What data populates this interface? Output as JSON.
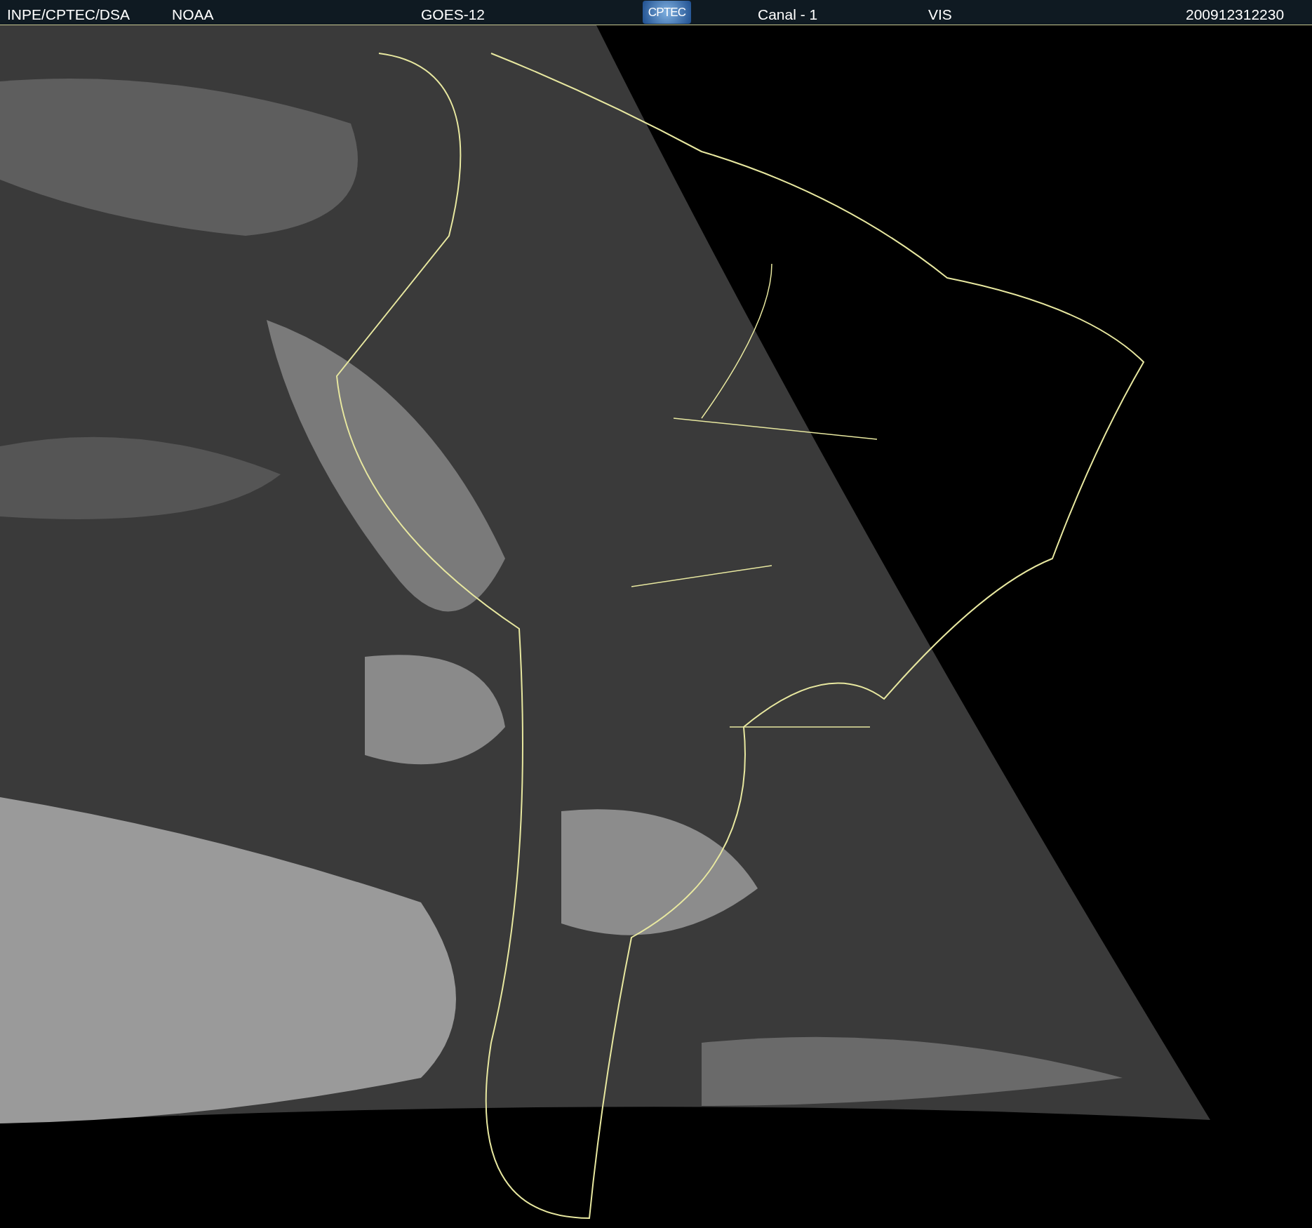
{
  "header": {
    "agency": "INPE/CPTEC/DSA",
    "source": "NOAA",
    "satellite": "GOES-12",
    "logo": "CPTEC",
    "channel": "Canal - 1",
    "band": "VIS",
    "timestamp": "200912312230"
  }
}
